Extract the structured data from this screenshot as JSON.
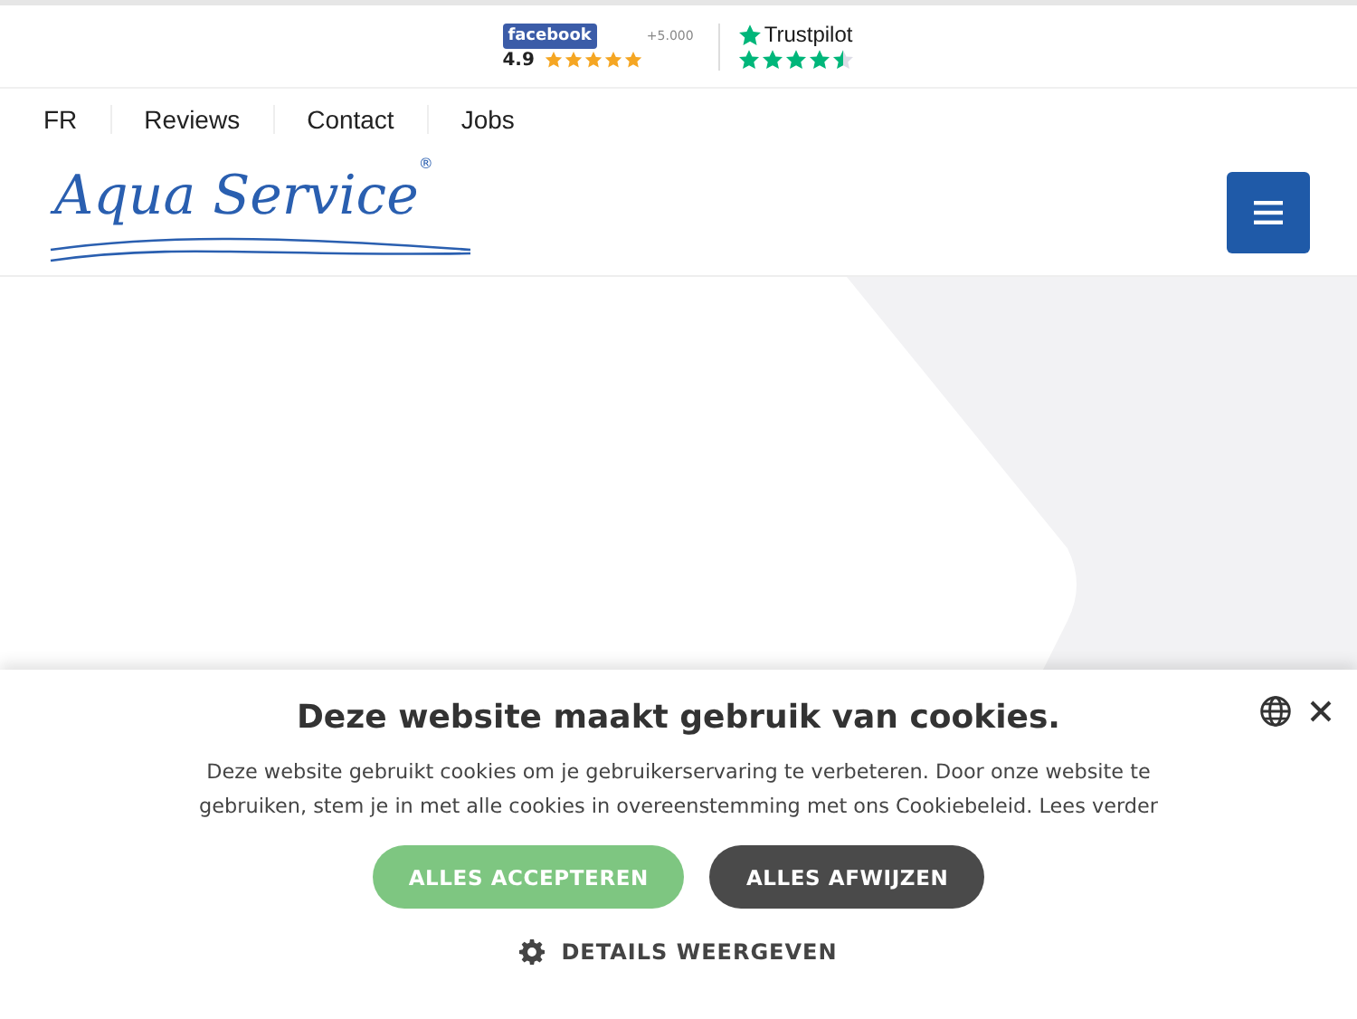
{
  "badges": {
    "facebook": {
      "name": "facebook",
      "rating": "4.9",
      "stars": 5,
      "count": "+5.000"
    },
    "trustpilot": {
      "name": "Trustpilot",
      "stars": 4.5
    }
  },
  "nav": [
    {
      "label": "FR"
    },
    {
      "label": "Reviews"
    },
    {
      "label": "Contact"
    },
    {
      "label": "Jobs"
    }
  ],
  "logo": {
    "text": "Aqua Service",
    "mark": "®"
  },
  "cookie_banner": {
    "title": "Deze website maakt gebruik van cookies.",
    "text": "Deze website gebruikt cookies om je gebruikerservaring te verbeteren. Door onze website te gebruiken, stem je in met alle cookies in overeenstemming met ons Cookiebeleid.",
    "link": "Lees verder",
    "buttons": [
      {
        "label": "ALLES ACCEPTEREN",
        "kind": "accept"
      },
      {
        "label": "ALLES AFWIJZEN",
        "kind": "reject"
      }
    ],
    "details": "DETAILS WEERGEVEN"
  }
}
